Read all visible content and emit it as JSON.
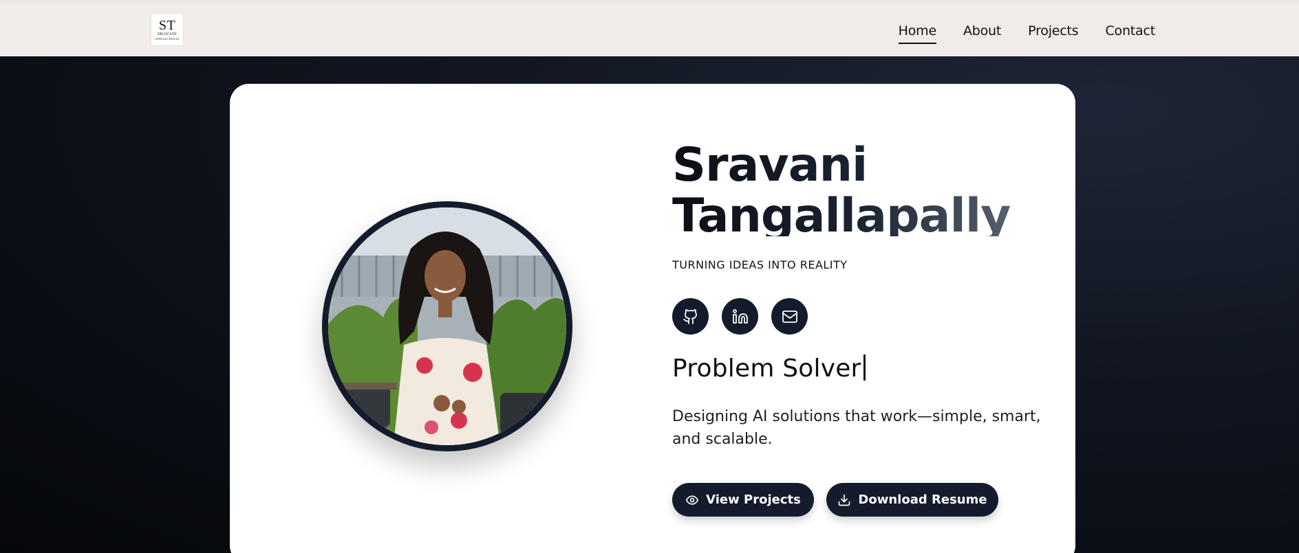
{
  "logo": {
    "mono": "ST",
    "line1": "SRAVANI",
    "line2": "TANGALLAPALLY"
  },
  "nav": {
    "items": [
      {
        "label": "Home",
        "active": true
      },
      {
        "label": "About",
        "active": false
      },
      {
        "label": "Projects",
        "active": false
      },
      {
        "label": "Contact",
        "active": false
      }
    ]
  },
  "hero": {
    "first_name": "Sravani",
    "last_name": "Tangallapally",
    "tagline": "TURNING IDEAS INTO REALITY",
    "typed_role": "Problem Solver",
    "description": "Designing AI solutions that work—simple, smart, and scalable.",
    "socials": [
      "github-icon",
      "linkedin-icon",
      "mail-icon"
    ],
    "buttons": {
      "view_projects": "View Projects",
      "download_resume": "Download Resume"
    }
  },
  "colors": {
    "navbar_bg": "#f1ece9",
    "accent_dark": "#141b2d",
    "page_bg": "#0a0d14"
  }
}
